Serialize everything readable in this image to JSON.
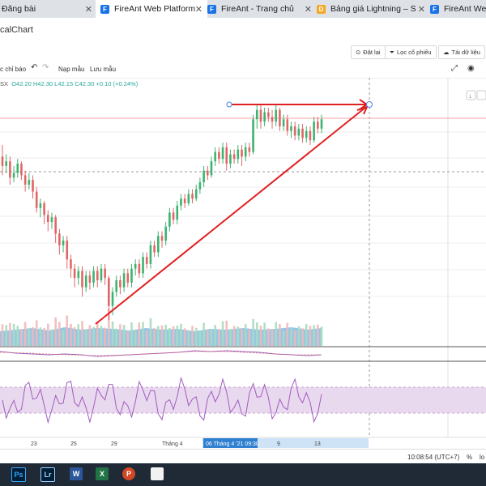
{
  "browser": {
    "tabs": [
      {
        "title": "Đăng bài",
        "active": false,
        "favicon": ""
      },
      {
        "title": "FireAnt Web Platform",
        "active": true,
        "favicon": "F"
      },
      {
        "title": "FireAnt - Trang chủ",
        "active": false,
        "favicon": "F"
      },
      {
        "title": "Bảng giá Lightning – S",
        "active": false,
        "favicon": "D"
      },
      {
        "title": "FireAnt Web",
        "active": false,
        "favicon": "F"
      }
    ]
  },
  "app": {
    "title": "calChart",
    "buttons": {
      "reset": "Đặt lại",
      "filter": "Lọc cổ phiếu",
      "download": "Tải dữ liệu"
    }
  },
  "chart_toolbar": {
    "indicators": "c chỉ báo",
    "load_template": "Nạp mẫu",
    "save_template": "Lưu mẫu"
  },
  "ohlc": {
    "symbol_suffix": "SX",
    "open": "O42.20",
    "high": "H42.30",
    "low": "L42.15",
    "close": "C42.30",
    "change": "+0.10 (+0.24%)"
  },
  "chart_data": {
    "type": "candlestick",
    "x_ticks": [
      "23",
      "25",
      "29",
      "Tháng 4",
      "9",
      "13"
    ],
    "crosshair_label": "06 Tháng 4 '21   09:30",
    "candles": [
      [
        18,
        14,
        23,
        10
      ],
      [
        14,
        16,
        19,
        11
      ],
      [
        16,
        9,
        18,
        6
      ],
      [
        9,
        11,
        14,
        7
      ],
      [
        11,
        15,
        17,
        9
      ],
      [
        15,
        10,
        16,
        8
      ],
      [
        10,
        6,
        12,
        3
      ],
      [
        6,
        8,
        11,
        4
      ],
      [
        8,
        3,
        10,
        0
      ],
      [
        3,
        -4,
        5,
        -6
      ],
      [
        -4,
        -2,
        0,
        -8
      ],
      [
        -2,
        -7,
        -1,
        -11
      ],
      [
        -7,
        -10,
        -5,
        -14
      ],
      [
        -10,
        -8,
        -6,
        -13
      ],
      [
        -8,
        -15,
        -7,
        -19
      ],
      [
        -15,
        -20,
        -13,
        -24
      ],
      [
        -20,
        -18,
        -16,
        -23
      ],
      [
        -18,
        -26,
        -16,
        -30
      ],
      [
        -26,
        -30,
        -24,
        -34
      ],
      [
        -30,
        -34,
        -28,
        -38
      ],
      [
        -34,
        -31,
        -29,
        -37
      ],
      [
        -31,
        -38,
        -29,
        -42
      ],
      [
        -38,
        -33,
        -31,
        -40
      ],
      [
        -33,
        -36,
        -31,
        -39
      ],
      [
        -36,
        -31,
        -29,
        -38
      ],
      [
        -31,
        -35,
        -29,
        -38
      ],
      [
        -35,
        -30,
        -28,
        -36
      ],
      [
        -30,
        -34,
        -28,
        -37
      ],
      [
        -34,
        -46,
        -33,
        -52
      ],
      [
        -46,
        -40,
        -38,
        -50
      ],
      [
        -40,
        -35,
        -33,
        -42
      ],
      [
        -35,
        -38,
        -33,
        -41
      ],
      [
        -38,
        -32,
        -30,
        -40
      ],
      [
        -32,
        -36,
        -30,
        -38
      ],
      [
        -36,
        -30,
        -28,
        -38
      ],
      [
        -30,
        -28,
        -26,
        -33
      ],
      [
        -28,
        -32,
        -26,
        -34
      ],
      [
        -32,
        -25,
        -23,
        -34
      ],
      [
        -25,
        -28,
        -23,
        -30
      ],
      [
        -28,
        -20,
        -18,
        -30
      ],
      [
        -20,
        -23,
        -18,
        -25
      ],
      [
        -23,
        -16,
        -14,
        -25
      ],
      [
        -16,
        -18,
        -14,
        -21
      ],
      [
        -18,
        -12,
        -10,
        -20
      ],
      [
        -12,
        -6,
        -4,
        -14
      ],
      [
        -6,
        -9,
        -4,
        -11
      ],
      [
        -9,
        -3,
        -1,
        -11
      ],
      [
        -3,
        0,
        2,
        -5
      ],
      [
        0,
        -2,
        2,
        -4
      ],
      [
        -2,
        2,
        4,
        -3
      ],
      [
        2,
        0,
        4,
        -2
      ],
      [
        0,
        4,
        6,
        -1
      ],
      [
        4,
        7,
        9,
        2
      ],
      [
        7,
        12,
        14,
        5
      ],
      [
        12,
        10,
        14,
        8
      ],
      [
        10,
        16,
        18,
        9
      ],
      [
        16,
        20,
        22,
        14
      ],
      [
        20,
        17,
        22,
        15
      ],
      [
        17,
        22,
        24,
        15
      ],
      [
        22,
        15,
        24,
        12
      ],
      [
        15,
        19,
        21,
        13
      ],
      [
        19,
        17,
        21,
        15
      ],
      [
        17,
        21,
        23,
        15
      ],
      [
        21,
        18,
        23,
        14
      ],
      [
        18,
        22,
        24,
        16
      ],
      [
        22,
        20,
        24,
        18
      ],
      [
        20,
        34,
        36,
        19
      ],
      [
        34,
        38,
        40,
        30
      ],
      [
        38,
        33,
        40,
        30
      ],
      [
        33,
        37,
        39,
        31
      ],
      [
        37,
        35,
        39,
        33
      ],
      [
        35,
        33,
        38,
        30
      ],
      [
        33,
        38,
        40,
        31
      ],
      [
        38,
        31,
        39,
        29
      ],
      [
        31,
        34,
        36,
        29
      ],
      [
        34,
        29,
        36,
        27
      ],
      [
        29,
        31,
        33,
        26
      ],
      [
        31,
        27,
        33,
        25
      ],
      [
        27,
        30,
        32,
        25
      ],
      [
        30,
        26,
        32,
        24
      ],
      [
        26,
        29,
        31,
        24
      ],
      [
        29,
        25,
        31,
        23
      ],
      [
        25,
        33,
        35,
        24
      ],
      [
        33,
        30,
        35,
        28
      ],
      [
        30,
        34,
        36,
        28
      ]
    ]
  },
  "status": {
    "time": "10:08:54 (UTC+7)",
    "percent": "%",
    "log": "lo"
  },
  "taskbar": {
    "apps": [
      "Ps",
      "Lr",
      "W",
      "X",
      "P",
      ""
    ]
  }
}
